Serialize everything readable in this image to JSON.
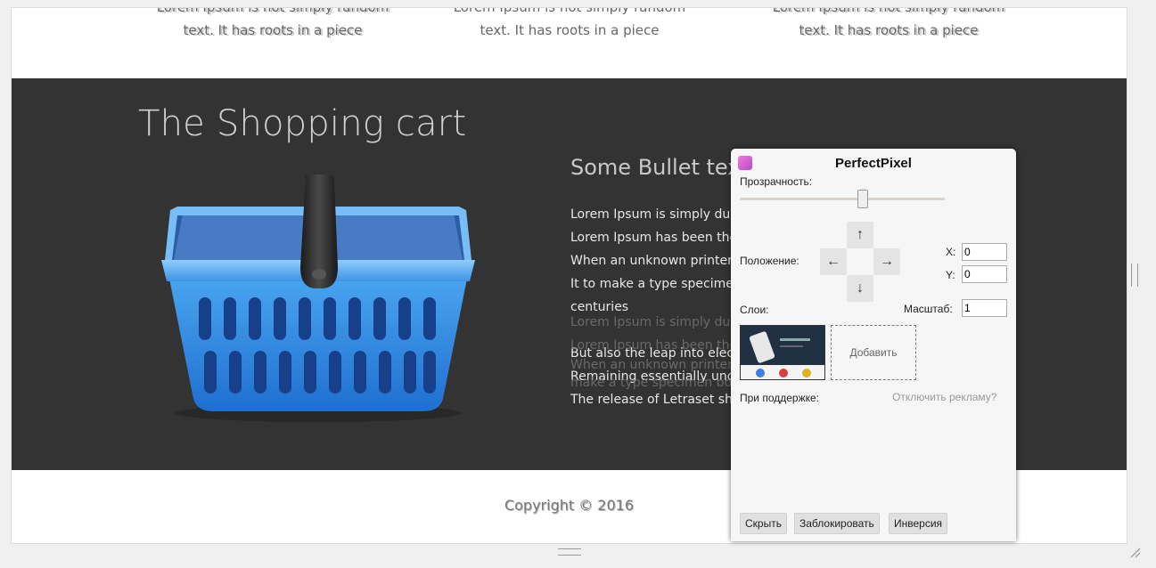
{
  "top": {
    "columns": [
      {
        "line1": "Lorem Ipsum is not simply random",
        "line2": "text. It has roots in a piece"
      },
      {
        "line1": "Lorem Ipsum is not simply random",
        "line2": "text. It has roots in a piece"
      },
      {
        "line1": "Lorem Ipsum is not simply random",
        "line2": "text. It has roots in a piece"
      }
    ]
  },
  "band": {
    "title": "The Shopping cart",
    "bullet_title": "Some Bullet tex",
    "bullets": [
      "Lorem Ipsum is simply du",
      "Lorem Ipsum has been the",
      "When an unknown printer",
      "It to make a type specimen",
      "centuries",
      "But also the leap into elec",
      "Remaining essentially unc",
      "The release of Letraset sh"
    ],
    "overlay_lines": [
      "Lorem Ipsum is simply du",
      "Lorem Ipsum has been the",
      "When an unknown printer",
      "make a type specimen bo"
    ]
  },
  "footer": {
    "copyright": "Copyright © 2016"
  },
  "perfectpixel": {
    "title": "PerfectPixel",
    "opacity_label": "Прозрачность:",
    "opacity_value": 0.6,
    "position_label": "Положение:",
    "arrows": {
      "up": "↑",
      "left": "←",
      "right": "→",
      "down": "↓"
    },
    "x_label": "X:",
    "x_value": "0",
    "y_label": "Y:",
    "y_value": "0",
    "layers_label": "Слои:",
    "scale_label": "Масштаб:",
    "scale_value": "1",
    "add_label": "Добавить",
    "support_label": "При поддержке:",
    "disable_ads": "Отключить рекламу?",
    "buttons": {
      "hide": "Скрыть",
      "lock": "Заблокировать",
      "invert": "Инверсия"
    },
    "logo_color": "#e070d0"
  }
}
